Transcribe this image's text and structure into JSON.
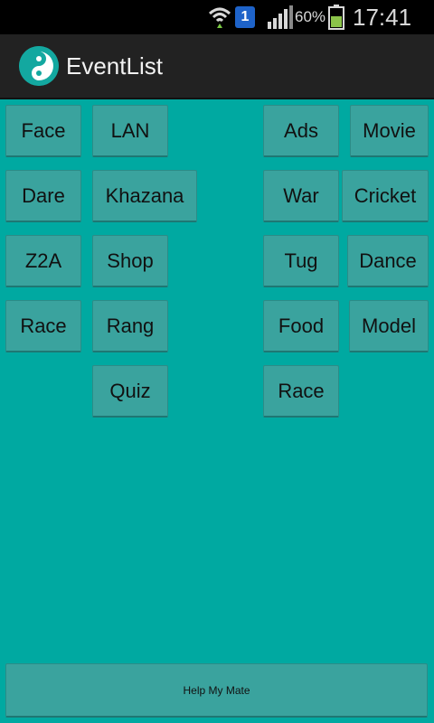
{
  "status_bar": {
    "sim_slot": "1",
    "battery_percent": "60%",
    "time": "17:41"
  },
  "action_bar": {
    "title": "EventList"
  },
  "events": {
    "left_col_1": [
      "Face",
      "Dare",
      "Z2A",
      "Race"
    ],
    "left_col_2": [
      "LAN",
      "Khazana",
      "Shop",
      "Rang",
      "Quiz"
    ],
    "right_col_1": [
      "Ads",
      "War",
      "Tug",
      "Food",
      "Race"
    ],
    "right_col_2": [
      "Movie",
      "Cricket",
      "Dance",
      "Model"
    ]
  },
  "footer": {
    "help_label": "Help My Mate"
  },
  "colors": {
    "background": "#00a9a1",
    "button": "#3aa39e",
    "action_bar": "#222222",
    "status_bar": "#000000"
  }
}
